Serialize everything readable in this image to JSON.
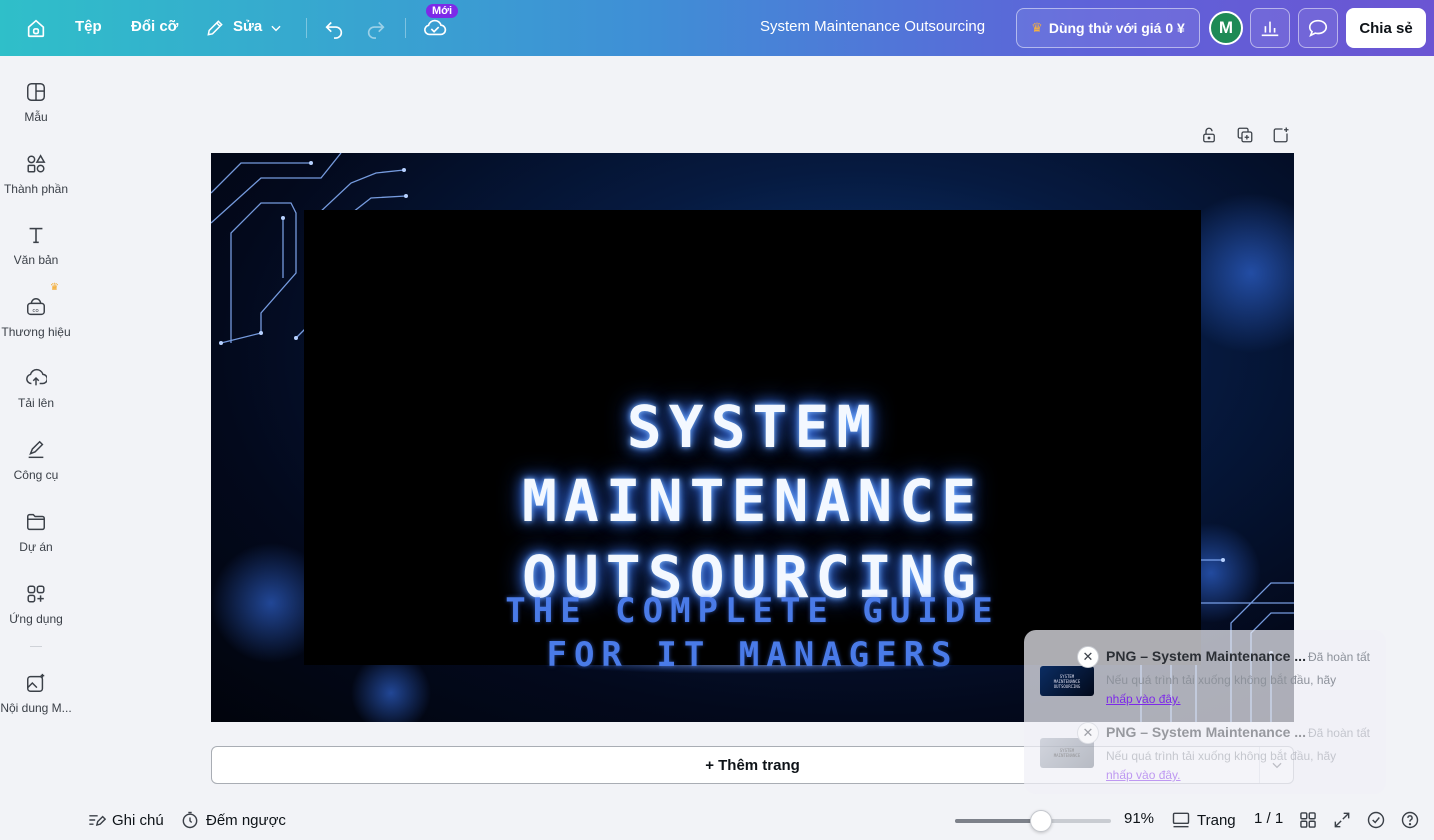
{
  "topbar": {
    "file_label": "Tệp",
    "resize_label": "Đổi cỡ",
    "edit_label": "Sửa",
    "new_badge": "Mới",
    "doc_title": "System Maintenance Outsourcing",
    "trial_label": "Dùng thử với giá 0 ¥",
    "avatar_initial": "M",
    "share_label": "Chia sẻ"
  },
  "sidebar": {
    "items": [
      {
        "label": "Mẫu",
        "icon": "template-icon"
      },
      {
        "label": "Thành phần",
        "icon": "elements-icon"
      },
      {
        "label": "Văn bản",
        "icon": "text-icon"
      },
      {
        "label": "Thương hiệu",
        "icon": "brand-icon"
      },
      {
        "label": "Tải lên",
        "icon": "upload-icon"
      },
      {
        "label": "Công cụ",
        "icon": "draw-icon"
      },
      {
        "label": "Dự án",
        "icon": "folder-icon"
      },
      {
        "label": "Ứng dụng",
        "icon": "apps-icon"
      },
      {
        "label": "Nội dung M...",
        "icon": "magic-media-icon"
      }
    ]
  },
  "slide": {
    "title_lines": [
      "SYSTEM",
      "MAINTENANCE",
      "OUTSOURCING"
    ],
    "subtitle_lines": [
      "THE COMPLETE GUIDE",
      "FOR IT MANAGERS"
    ]
  },
  "add_page_label": "+ Thêm trang",
  "bottombar": {
    "notes_label": "Ghi chú",
    "timer_label": "Đếm ngược",
    "zoom_percent": "91%",
    "zoom_level": 0.55,
    "pages_label": "Trang",
    "page_counter": "1 / 1"
  },
  "notifications": [
    {
      "title": "PNG – System Maintenance ...",
      "status": "Đã hoàn tất",
      "desc": "Nếu quá trình tải xuống không bắt đầu, hãy",
      "link": "nhấp vào đây."
    },
    {
      "title": "PNG – System Maintenance ...",
      "status": "Đã hoàn tất",
      "desc": "Nếu quá trình tải xuống không bắt đầu, hãy",
      "link": "nhấp vào đây."
    }
  ],
  "colors": {
    "brand_purple": "#7d2ae8",
    "avatar_green": "#1e8a56",
    "title_glow": "#3d7cff",
    "subtitle_blue": "#4a7be8"
  }
}
